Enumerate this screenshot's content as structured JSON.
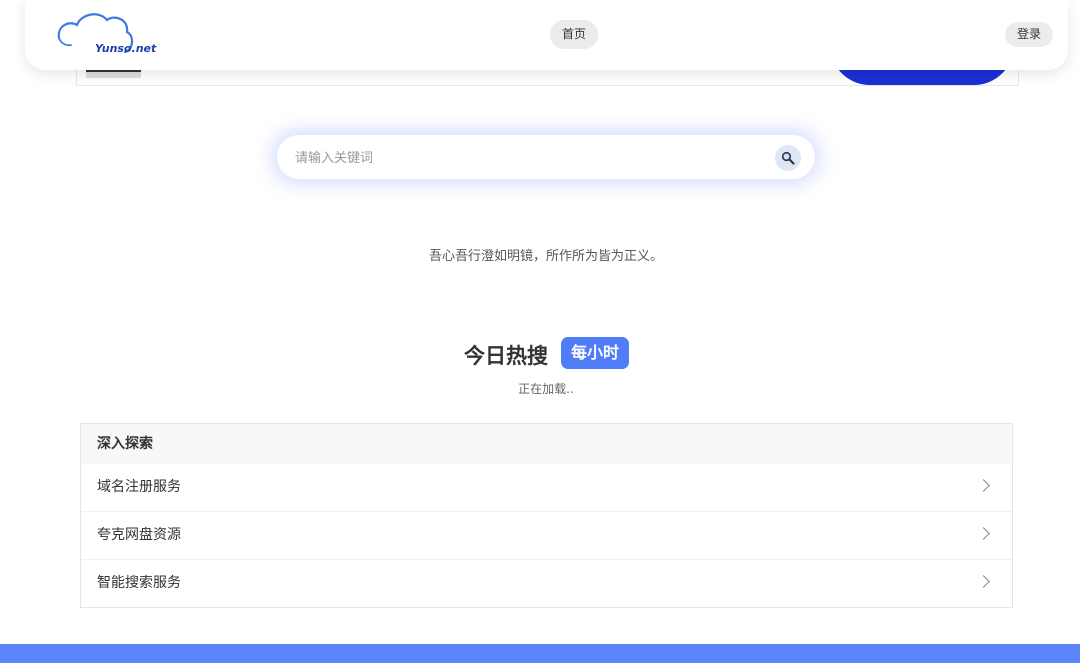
{
  "header": {
    "logo_text": "Yunso.net",
    "nav_home": "首页",
    "login": "登录"
  },
  "search": {
    "placeholder": "请输入关键词",
    "value": ""
  },
  "motto": "吾心吾行澄如明镜，所作所为皆为正义。",
  "hot": {
    "title": "今日热搜",
    "badge": "每小时",
    "status": "正在加载.."
  },
  "explore": {
    "title": "深入探索",
    "items": [
      {
        "label": "域名注册服务"
      },
      {
        "label": "夸克网盘资源"
      },
      {
        "label": "智能搜索服务"
      }
    ]
  },
  "colors": {
    "accent": "#4f7cf7",
    "footer": "#5b86fb",
    "banner_blue": "#1a2fd6"
  }
}
